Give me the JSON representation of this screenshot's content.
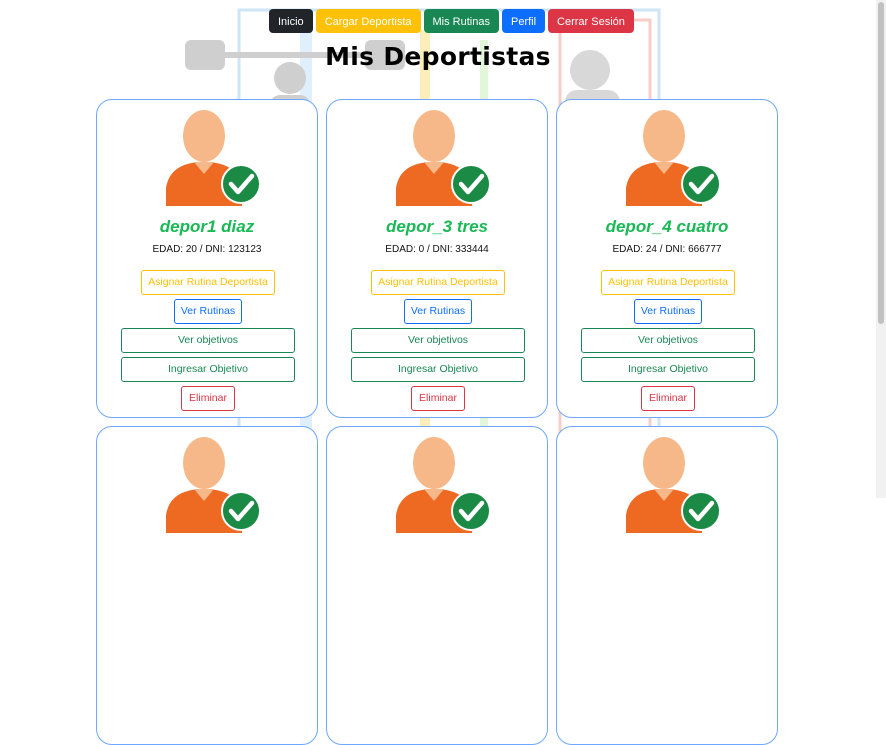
{
  "nav": {
    "inicio": "Inicio",
    "cargar": "Cargar Deportista",
    "rutinas": "Mis Rutinas",
    "perfil": "Perfil",
    "cerrar": "Cerrar Sesión"
  },
  "page_title": "Mis Deportistas",
  "deportistas": [
    {
      "nombre": "depor1 diaz",
      "info": "EDAD: 20 / DNI: 123123"
    },
    {
      "nombre": "depor_3 tres",
      "info": "EDAD: 0 / DNI: 333444"
    },
    {
      "nombre": "depor_4 cuatro",
      "info": "EDAD: 24 / DNI: 666777"
    }
  ],
  "card_buttons": {
    "asignar": "Asignar Rutina Deportista",
    "ver_rutinas": "Ver Rutinas",
    "ver_objetivos": "Ver objetivos",
    "ingresar": "Ingresar Objetivo",
    "eliminar": "Eliminar"
  },
  "colors": {
    "name": "#19b955",
    "card_border": "#6ea8fe",
    "check": "#1b8a45",
    "shirt": "#ee6a22",
    "skin": "#f7b889"
  },
  "icons": {
    "avatar": "user-check-icon"
  }
}
